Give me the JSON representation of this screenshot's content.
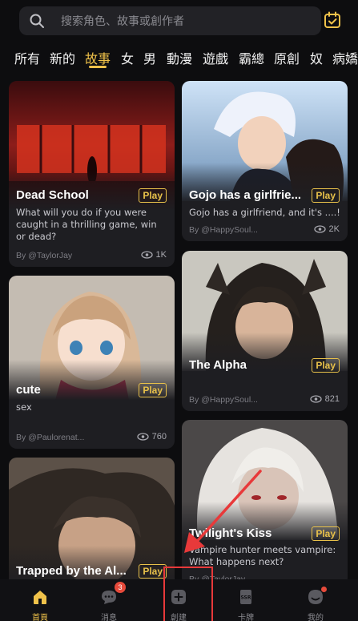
{
  "search": {
    "placeholder": "搜索角色、故事或創作者"
  },
  "tabs": [
    "所有",
    "新的",
    "故事",
    "女",
    "男",
    "動漫",
    "遊戲",
    "霸總",
    "原創",
    "奴",
    "病嬌"
  ],
  "active_tab": "故事",
  "play_label": "Play",
  "cards": [
    {
      "title": "Dead School",
      "desc": "What will you do if you were caught in a thrilling game, win or dead?",
      "author": "By @TaylorJay",
      "views": "1K"
    },
    {
      "title": "Gojo has a girlfrie...",
      "desc": "Gojo has a girlfriend, and it's ....!",
      "author": "By @HappySoul...",
      "views": "2K"
    },
    {
      "title": "cute",
      "desc": "sex",
      "author": "By @Paulorenat...",
      "views": "760"
    },
    {
      "title": "The Alpha",
      "desc": "",
      "author": "By @HappySoul...",
      "views": "821"
    },
    {
      "title": "Trapped by the Al...",
      "desc": "",
      "author": "",
      "views": ""
    },
    {
      "title": "Twilight's Kiss",
      "desc": "Vampire hunter meets vampire: What happens next?",
      "author": "By @TaylorJay",
      "views": ""
    }
  ],
  "nav": [
    {
      "label": "首頁",
      "icon": "home-icon",
      "active": true
    },
    {
      "label": "消息",
      "icon": "chat-icon",
      "badge": "3"
    },
    {
      "label": "創建",
      "icon": "create-icon"
    },
    {
      "label": "卡牌",
      "icon": "card-icon"
    },
    {
      "label": "我的",
      "icon": "profile-icon",
      "dot": true
    }
  ],
  "colors": {
    "accent": "#f0c24a",
    "annotation": "#e8393a",
    "background": "#0d0d0f"
  }
}
